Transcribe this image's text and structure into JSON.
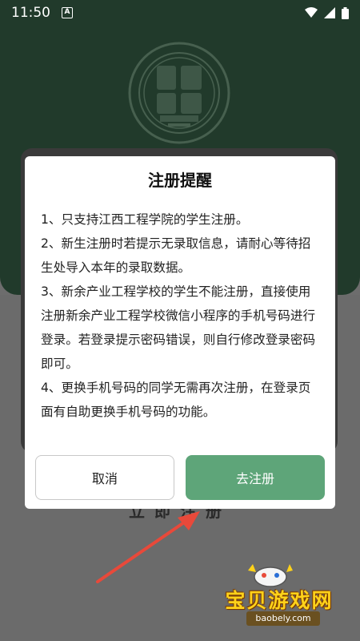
{
  "status_bar": {
    "time": "11:50",
    "notification_badge": "A"
  },
  "dialog": {
    "title": "注册提醒",
    "lines": [
      "1、只支持江西工程学院的学生注册。",
      "2、新生注册时若提示无录取信息，请耐心等待招生处导入本年的录取数据。",
      "3、新余产业工程学校的学生不能注册，直接使用注册新余产业工程学校微信小程序的手机号码进行登录。若登录提示密码错误，则自行修改登录密码即可。",
      "4、更换手机号码的同学无需再次注册，在登录页面有自助更换手机号码的功能。"
    ],
    "cancel_label": "取消",
    "confirm_label": "去注册"
  },
  "background": {
    "register_label": "立即注册"
  },
  "watermark": {
    "brand": "宝贝游戏网",
    "url": "baobely.com"
  },
  "colors": {
    "header": "#213a2b",
    "accent": "#5ea579",
    "overlay": "#6d6d6d"
  }
}
